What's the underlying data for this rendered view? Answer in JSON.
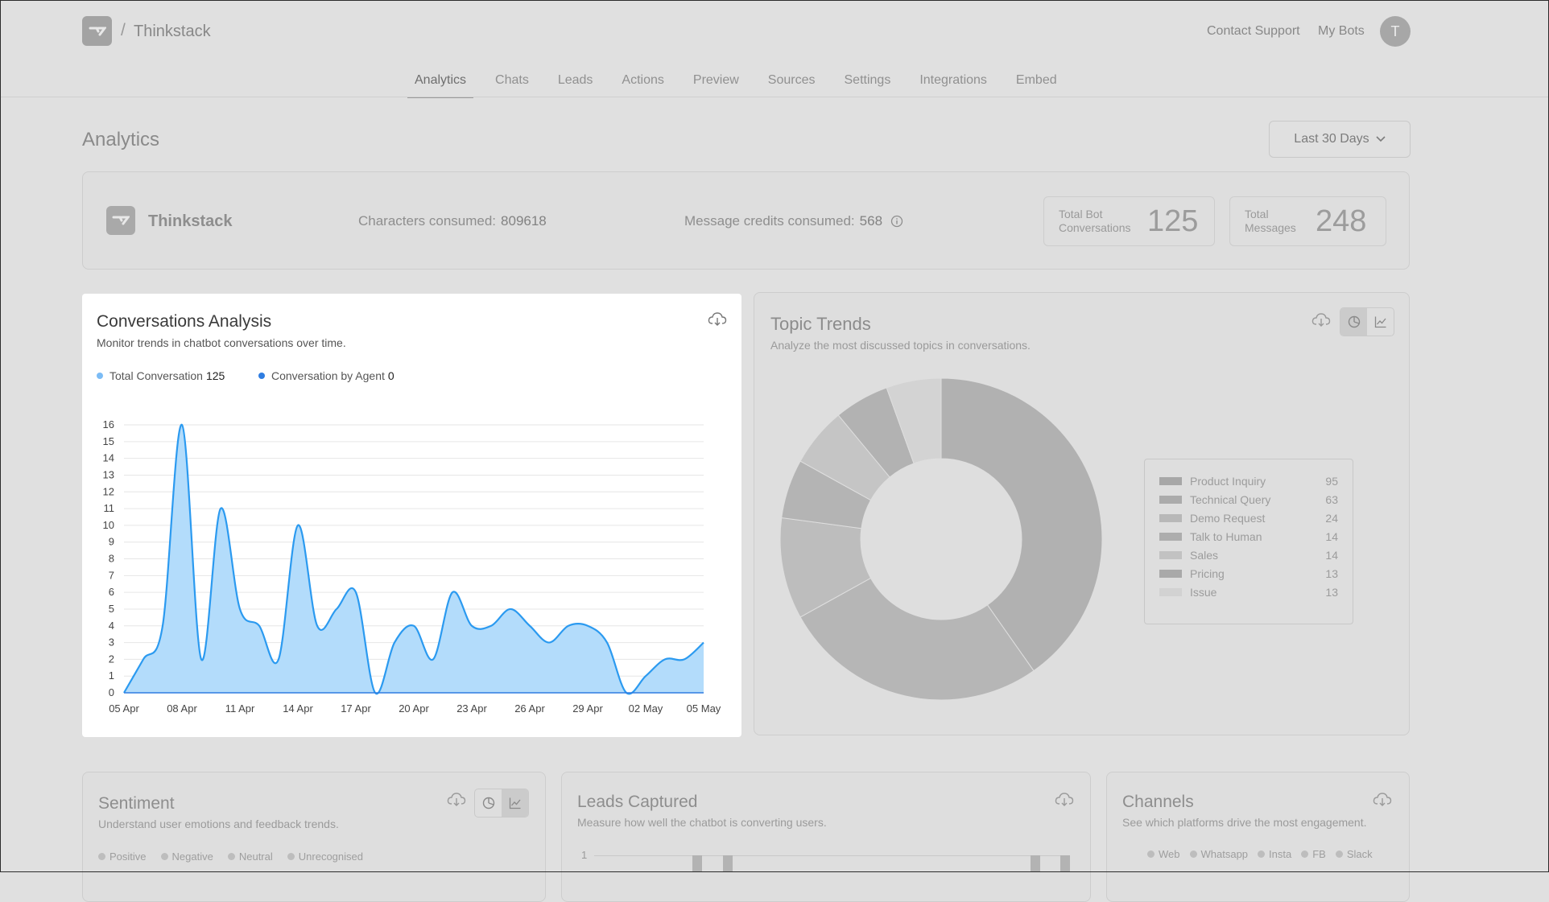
{
  "header": {
    "separator": "/",
    "brand": "Thinkstack",
    "contact_support": "Contact Support",
    "my_bots": "My Bots",
    "avatar_initial": "T"
  },
  "nav": {
    "tabs": [
      {
        "label": "Analytics",
        "active": true
      },
      {
        "label": "Chats"
      },
      {
        "label": "Leads"
      },
      {
        "label": "Actions"
      },
      {
        "label": "Preview"
      },
      {
        "label": "Sources"
      },
      {
        "label": "Settings"
      },
      {
        "label": "Integrations"
      },
      {
        "label": "Embed"
      }
    ]
  },
  "page": {
    "title": "Analytics",
    "date_range": "Last 30 Days"
  },
  "summary": {
    "bot_name": "Thinkstack",
    "characters_label": "Characters consumed:",
    "characters_value": "809618",
    "credits_label": "Message credits consumed:",
    "credits_value": "568",
    "kpis": [
      {
        "label_line1": "Total Bot",
        "label_line2": "Conversations",
        "value": "125"
      },
      {
        "label_line1": "Total",
        "label_line2": "Messages",
        "value": "248"
      }
    ]
  },
  "conversations": {
    "title": "Conversations Analysis",
    "subtitle": "Monitor trends in chatbot conversations over time.",
    "legend": [
      {
        "label": "Total Conversation",
        "value": "125",
        "color": "#7cbcf5"
      },
      {
        "label": "Conversation by Agent",
        "value": "0",
        "color": "#2f7de1"
      }
    ]
  },
  "chart_data": {
    "type": "area",
    "series": [
      {
        "name": "Total Conversation",
        "values": [
          0,
          2,
          4,
          16,
          2,
          11,
          5,
          4,
          2,
          10,
          4,
          5,
          6,
          0,
          3,
          4,
          2,
          6,
          4,
          4,
          5,
          4,
          3,
          4,
          4,
          3,
          0,
          1,
          2,
          2,
          3
        ]
      },
      {
        "name": "Conversation by Agent",
        "values": [
          0,
          0,
          0,
          0,
          0,
          0,
          0,
          0,
          0,
          0,
          0,
          0,
          0,
          0,
          0,
          0,
          0,
          0,
          0,
          0,
          0,
          0,
          0,
          0,
          0,
          0,
          0,
          0,
          0,
          0,
          0
        ]
      }
    ],
    "x": [
      "05 Apr",
      "06 Apr",
      "07 Apr",
      "08 Apr",
      "09 Apr",
      "10 Apr",
      "11 Apr",
      "12 Apr",
      "13 Apr",
      "14 Apr",
      "15 Apr",
      "16 Apr",
      "17 Apr",
      "18 Apr",
      "19 Apr",
      "20 Apr",
      "21 Apr",
      "22 Apr",
      "23 Apr",
      "24 Apr",
      "25 Apr",
      "26 Apr",
      "27 Apr",
      "28 Apr",
      "29 Apr",
      "30 Apr",
      "01 May",
      "02 May",
      "03 May",
      "04 May",
      "05 May"
    ],
    "xticks": [
      "05 Apr",
      "08 Apr",
      "11 Apr",
      "14 Apr",
      "17 Apr",
      "20 Apr",
      "23 Apr",
      "26 Apr",
      "29 Apr",
      "02 May",
      "05 May"
    ],
    "yticks": [
      0,
      1,
      2,
      3,
      4,
      5,
      6,
      7,
      8,
      9,
      10,
      11,
      12,
      13,
      14,
      15,
      16
    ],
    "ylim": [
      0,
      16
    ],
    "grid": true,
    "color": "#2b9af0",
    "fill": "#b3dcfb"
  },
  "topics": {
    "title": "Topic Trends",
    "subtitle": "Analyze the most discussed topics in conversations.",
    "items": [
      {
        "label": "Product Inquiry",
        "value": 95,
        "color": "#b1b1b1"
      },
      {
        "label": "Technical Query",
        "value": 63,
        "color": "#b6b6b6"
      },
      {
        "label": "Demo Request",
        "value": 24,
        "color": "#bdbdbd"
      },
      {
        "label": "Talk to Human",
        "value": 14,
        "color": "#b4b4b4"
      },
      {
        "label": "Sales",
        "value": 14,
        "color": "#c5c5c5"
      },
      {
        "label": "Pricing",
        "value": 13,
        "color": "#b2b2b2"
      },
      {
        "label": "Issue",
        "value": 13,
        "color": "#d3d3d3"
      }
    ]
  },
  "sentiment": {
    "title": "Sentiment",
    "subtitle": "Understand user emotions and feedback trends.",
    "legend": [
      "Positive",
      "Negative",
      "Neutral",
      "Unrecognised"
    ]
  },
  "leads": {
    "title": "Leads Captured",
    "subtitle": "Measure how well the chatbot is converting users.",
    "y_tick": "1"
  },
  "channels": {
    "title": "Channels",
    "subtitle": "See which platforms drive the most engagement.",
    "legend": [
      "Web",
      "Whatsapp",
      "Insta",
      "FB",
      "Slack"
    ]
  }
}
